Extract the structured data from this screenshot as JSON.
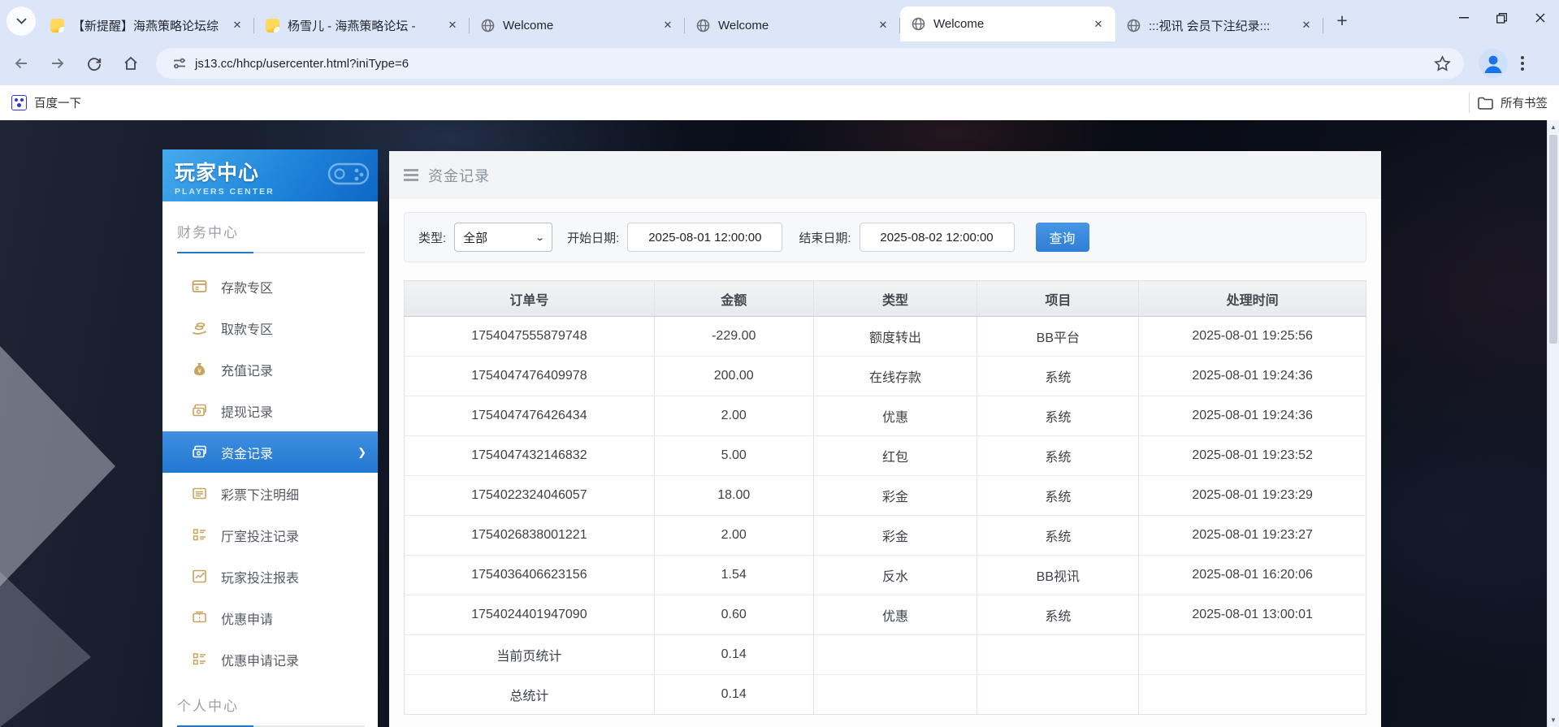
{
  "browser": {
    "tabs": [
      {
        "title": "【新提醒】海燕策略论坛综",
        "icon": "forum-favicon",
        "active": false
      },
      {
        "title": "杨雪儿 - 海燕策略论坛 -",
        "icon": "forum-favicon",
        "active": false
      },
      {
        "title": "Welcome",
        "icon": "globe-favicon",
        "active": false
      },
      {
        "title": "Welcome",
        "icon": "globe-favicon",
        "active": false
      },
      {
        "title": "Welcome",
        "icon": "globe-favicon",
        "active": true
      },
      {
        "title": ":::视讯 会员下注纪录:::",
        "icon": "globe-favicon",
        "active": false
      }
    ],
    "url": "js13.cc/hhcp/usercenter.html?iniType=6",
    "bookmark_left": "百度一下",
    "bookmark_right": "所有书签",
    "icons": {
      "tab_search": "⌄",
      "new_tab": "+",
      "minimize": "—",
      "maximize": "❐",
      "close": "✕",
      "menu": "⋮",
      "scroll_up": "▲",
      "scroll_down": "▼",
      "chevron": "❯",
      "select_caret": "⌄"
    }
  },
  "sidebar": {
    "title": "玩家中心",
    "subtitle": "PLAYERS CENTER",
    "finance_heading": "财务中心",
    "personal_heading": "个人中心",
    "items": [
      {
        "label": "存款专区",
        "icon": "deposit-icon",
        "active": false
      },
      {
        "label": "取款专区",
        "icon": "withdraw-icon",
        "active": false
      },
      {
        "label": "充值记录",
        "icon": "moneybag-icon",
        "active": false
      },
      {
        "label": "提现记录",
        "icon": "wallet-icon",
        "active": false
      },
      {
        "label": "资金记录",
        "icon": "banknotes-icon",
        "active": true
      },
      {
        "label": "彩票下注明细",
        "icon": "receipt-icon",
        "active": false
      },
      {
        "label": "厅室投注记录",
        "icon": "list-icon",
        "active": false
      },
      {
        "label": "玩家投注报表",
        "icon": "chart-icon",
        "active": false
      },
      {
        "label": "优惠申请",
        "icon": "coupon-icon",
        "active": false
      },
      {
        "label": "优惠申请记录",
        "icon": "list-icon",
        "active": false
      }
    ]
  },
  "main": {
    "page_title": "资金记录",
    "filter": {
      "type_label": "类型:",
      "type_value": "全部",
      "start_label": "开始日期:",
      "start_value": "2025-08-01 12:00:00",
      "end_label": "结束日期:",
      "end_value": "2025-08-02 12:00:00",
      "search_button": "查询"
    },
    "table": {
      "headers": [
        "订单号",
        "金额",
        "类型",
        "项目",
        "处理时间"
      ],
      "rows": [
        [
          "1754047555879748",
          "-229.00",
          "额度转出",
          "BB平台",
          "2025-08-01 19:25:56"
        ],
        [
          "1754047476409978",
          "200.00",
          "在线存款",
          "系统",
          "2025-08-01 19:24:36"
        ],
        [
          "1754047476426434",
          "2.00",
          "优惠",
          "系统",
          "2025-08-01 19:24:36"
        ],
        [
          "1754047432146832",
          "5.00",
          "红包",
          "系统",
          "2025-08-01 19:23:52"
        ],
        [
          "1754022324046057",
          "18.00",
          "彩金",
          "系统",
          "2025-08-01 19:23:29"
        ],
        [
          "1754026838001221",
          "2.00",
          "彩金",
          "系统",
          "2025-08-01 19:23:27"
        ],
        [
          "1754036406623156",
          "1.54",
          "反水",
          "BB视讯",
          "2025-08-01 16:20:06"
        ],
        [
          "1754024401947090",
          "0.60",
          "优惠",
          "系统",
          "2025-08-01 13:00:01"
        ],
        [
          "当前页统计",
          "0.14",
          "",
          "",
          ""
        ],
        [
          "总统计",
          "0.14",
          "",
          "",
          ""
        ]
      ]
    }
  },
  "colors": {
    "chrome_bg": "#dce6f8",
    "accent_blue": "#2377d0",
    "button_blue": "#2f7fd6",
    "sidebar_gold": "#c7a45e",
    "active_item": "#2e82d8",
    "dark_bg": "#0c111d",
    "table_divider_v": "#f2dcdc",
    "table_divider_h": "#e3ecf4"
  }
}
